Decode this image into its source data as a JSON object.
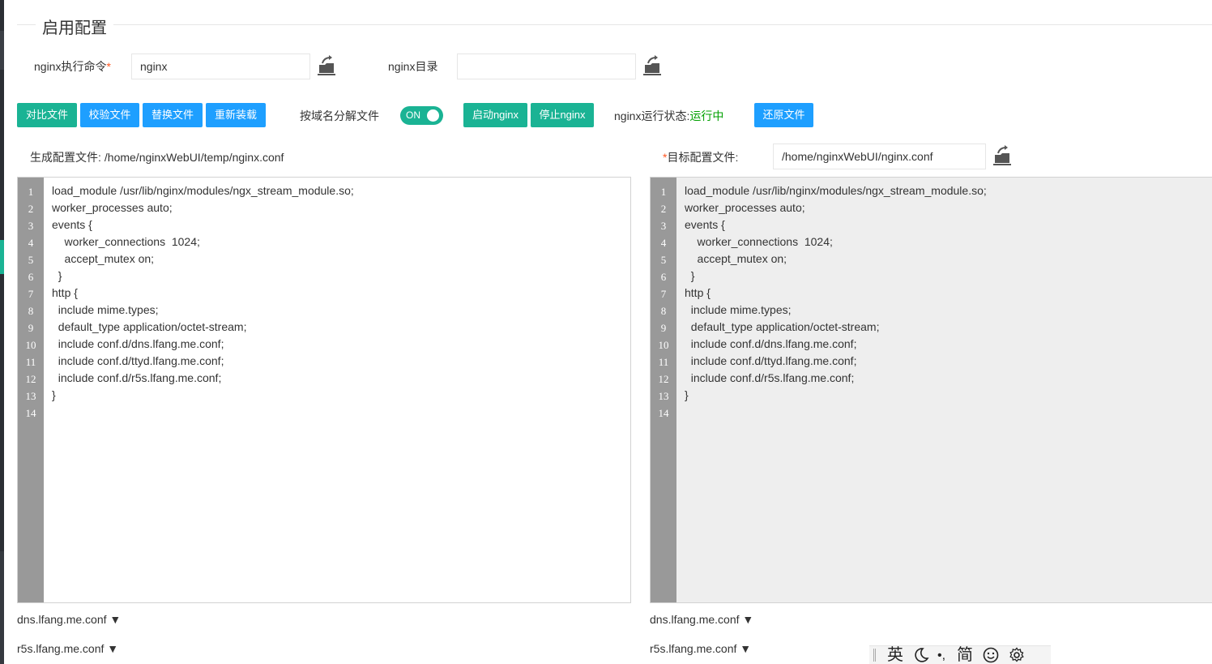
{
  "section": {
    "title": "启用配置"
  },
  "form": {
    "cmd_label": "nginx执行命令",
    "required_mark": "*",
    "cmd_value": "nginx",
    "dir_label": "nginx目录",
    "dir_value": ""
  },
  "toolbar": {
    "compare": "对比文件",
    "verify": "校验文件",
    "replace": "替换文件",
    "reload": "重新装载",
    "split_label": "按域名分解文件",
    "split_toggle": "ON",
    "start": "启动nginx",
    "stop": "停止nginx",
    "status_label": "nginx运行状态:",
    "status_value": "运行中",
    "restore": "还原文件"
  },
  "generated": {
    "label": "生成配置文件:",
    "path": "/home/nginxWebUI/temp/nginx.conf"
  },
  "target": {
    "label": "目标配置文件:",
    "path": "/home/nginxWebUI/nginx.conf"
  },
  "editor_lines": [
    "load_module /usr/lib/nginx/modules/ngx_stream_module.so;",
    "worker_processes auto;",
    "events {",
    "    worker_connections  1024;",
    "    accept_mutex on;",
    "  }",
    "http {",
    "  include mime.types;",
    "  default_type application/octet-stream;",
    "  include conf.d/dns.lfang.me.conf;",
    "  include conf.d/ttyd.lfang.me.conf;",
    "  include conf.d/r5s.lfang.me.conf;",
    "}",
    ""
  ],
  "line_numbers": [
    "1",
    "2",
    "3",
    "4",
    "5",
    "6",
    "7",
    "8",
    "9",
    "10",
    "11",
    "12",
    "13",
    "14"
  ],
  "files": [
    "dns.lfang.me.conf ▼",
    "r5s.lfang.me.conf ▼"
  ],
  "ime": {
    "lang": "英",
    "punct": "•,",
    "script": "简"
  },
  "colors": {
    "green": "#1ab394",
    "blue": "#1e9fff",
    "status": "#00a000",
    "gutter": "#999999",
    "readonly_bg": "#eeeeee"
  }
}
